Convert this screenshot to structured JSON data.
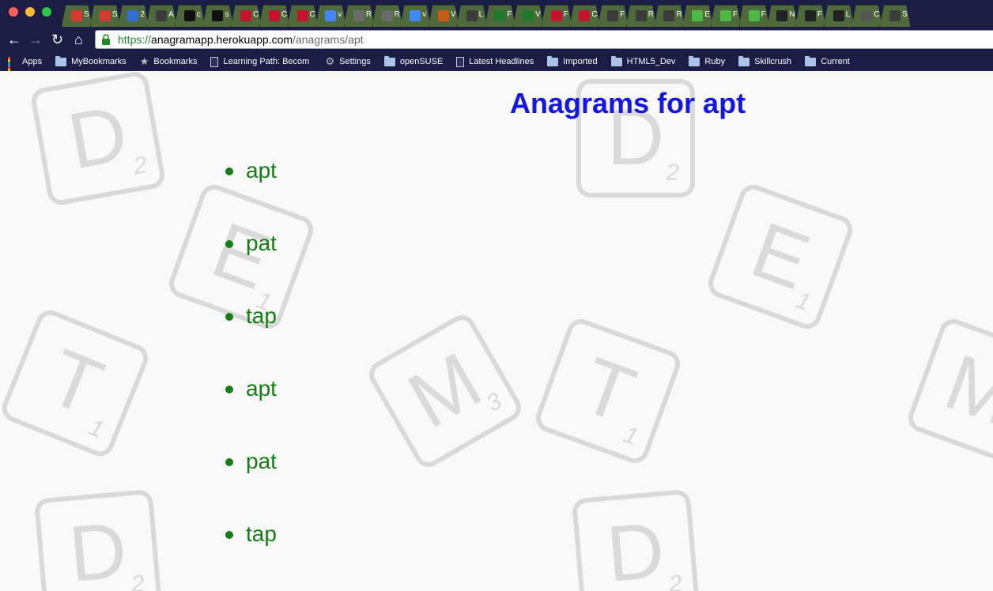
{
  "browser": {
    "tabs": [
      {
        "favicon_icon": "red-circle-icon",
        "label": "S",
        "color": "#d23a2e"
      },
      {
        "favicon_icon": "red-circle-icon",
        "label": "S",
        "color": "#d23a2e"
      },
      {
        "favicon_icon": "blue-chat-icon",
        "label": "2",
        "color": "#2d6fd6"
      },
      {
        "favicon_icon": "dark-square-icon",
        "label": "A",
        "color": "#3b3b3b"
      },
      {
        "favicon_icon": "github-icon",
        "label": "c",
        "color": "#111111"
      },
      {
        "favicon_icon": "github-icon",
        "label": "s",
        "color": "#111111"
      },
      {
        "favicon_icon": "red-code-icon",
        "label": "C",
        "color": "#c4122f"
      },
      {
        "favicon_icon": "red-code-icon",
        "label": "C",
        "color": "#c4122f"
      },
      {
        "favicon_icon": "red-code-icon",
        "label": "C",
        "color": "#c4122f"
      },
      {
        "favicon_icon": "google-icon",
        "label": "v",
        "color": "#4285f4"
      },
      {
        "favicon_icon": "tree-icon",
        "label": "R",
        "color": "#6b6b6b"
      },
      {
        "favicon_icon": "tree-icon",
        "label": "R",
        "color": "#6b6b6b"
      },
      {
        "favicon_icon": "google-icon",
        "label": "v",
        "color": "#4285f4"
      },
      {
        "favicon_icon": "orange-circle-icon",
        "label": "V",
        "color": "#c85a1a"
      },
      {
        "favicon_icon": "dark-square-icon",
        "label": "L",
        "color": "#3b3b3b"
      },
      {
        "favicon_icon": "green-terminal-icon",
        "label": "F",
        "color": "#1c7a2c"
      },
      {
        "favicon_icon": "green-terminal-icon",
        "label": "V",
        "color": "#1c7a2c"
      },
      {
        "favicon_icon": "rp-icon",
        "label": "F",
        "color": "#c4122f"
      },
      {
        "favicon_icon": "rp-icon",
        "label": "C",
        "color": "#c4122f"
      },
      {
        "favicon_icon": "dark-square-icon",
        "label": "F",
        "color": "#3b3b3b"
      },
      {
        "favicon_icon": "dark-square-icon",
        "label": "R",
        "color": "#3b3b3b"
      },
      {
        "favicon_icon": "dark-square-icon",
        "label": "R",
        "color": "#3b3b3b"
      },
      {
        "favicon_icon": "green-u-icon",
        "label": "E",
        "color": "#4cb944"
      },
      {
        "favicon_icon": "green-u-icon",
        "label": "F",
        "color": "#4cb944"
      },
      {
        "favicon_icon": "green-u-icon",
        "label": "F",
        "color": "#4cb944"
      },
      {
        "favicon_icon": "panda-icon",
        "label": "N",
        "color": "#222222"
      },
      {
        "favicon_icon": "panda-icon",
        "label": "F",
        "color": "#222222"
      },
      {
        "favicon_icon": "panda-icon",
        "label": "L",
        "color": "#222222"
      },
      {
        "favicon_icon": "o-icon",
        "label": "C",
        "color": "#555555"
      },
      {
        "favicon_icon": "dark-square-icon",
        "label": "S",
        "color": "#3b3b3b"
      }
    ],
    "address": {
      "scheme": "https://",
      "host": "anagramapp.herokuapp.com",
      "path": "/anagrams/apt"
    },
    "bookmarks": [
      {
        "icon": "apps-grid-icon",
        "label": "Apps"
      },
      {
        "icon": "folder-icon",
        "label": "MyBookmarks"
      },
      {
        "icon": "star-icon",
        "label": "Bookmarks"
      },
      {
        "icon": "document-icon",
        "label": "Learning Path: Becom"
      },
      {
        "icon": "gear-icon",
        "label": "Settings"
      },
      {
        "icon": "folder-icon",
        "label": "openSUSE"
      },
      {
        "icon": "document-icon",
        "label": "Latest Headlines"
      },
      {
        "icon": "folder-icon",
        "label": "Imported"
      },
      {
        "icon": "folder-icon",
        "label": "HTML5_Dev"
      },
      {
        "icon": "folder-icon",
        "label": "Ruby"
      },
      {
        "icon": "folder-icon",
        "label": "Skillcrush"
      },
      {
        "icon": "folder-icon",
        "label": "Current"
      }
    ]
  },
  "page": {
    "title": "Anagrams for apt",
    "results": [
      "apt",
      "pat",
      "tap",
      "apt",
      "pat",
      "tap"
    ],
    "background_tiles": [
      {
        "letter": "D",
        "score": "2"
      },
      {
        "letter": "D",
        "score": "2"
      },
      {
        "letter": "E",
        "score": "1"
      },
      {
        "letter": "E",
        "score": "1"
      },
      {
        "letter": "T",
        "score": "1"
      },
      {
        "letter": "M",
        "score": "3"
      },
      {
        "letter": "T",
        "score": "1"
      },
      {
        "letter": "M",
        "score": ""
      },
      {
        "letter": "D",
        "score": "2"
      },
      {
        "letter": "D",
        "score": "2"
      }
    ]
  },
  "colors": {
    "title": "#1414f0",
    "result_text": "#137f13",
    "chrome_bar": "#1b1d44",
    "url_scheme": "#1e8b28"
  }
}
